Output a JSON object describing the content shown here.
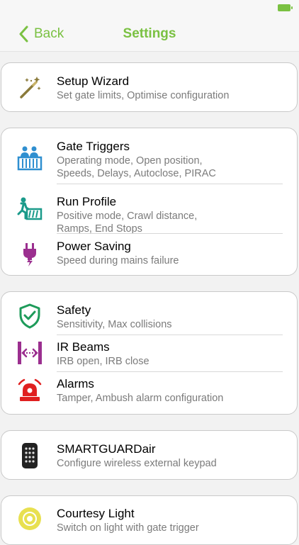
{
  "nav": {
    "back_label": "Back",
    "title": "Settings"
  },
  "colors": {
    "accent": "#7ac142",
    "wizard": "#8a7a3a",
    "blue": "#2f8fd0",
    "teal": "#1a9a8a",
    "purple": "#9b2f8f",
    "green": "#1e9b5a",
    "red": "#e02020",
    "yellow": "#e8e050"
  },
  "groups": [
    {
      "items": [
        {
          "title": "Setup Wizard",
          "subtitle": [
            "Set gate limits, Optimise configuration"
          ],
          "icon": "magic-wand-icon"
        }
      ]
    },
    {
      "items": [
        {
          "title": "Gate Triggers",
          "subtitle": [
            "Operating mode, Open position,",
            "Speeds, Delays, Autoclose, PIRAC"
          ],
          "icon": "gate-people-icon"
        },
        {
          "title": "Run Profile",
          "subtitle": [
            "Positive mode, Crawl distance,",
            "Ramps, End Stops"
          ],
          "icon": "running-gate-icon"
        },
        {
          "title": "Power Saving",
          "subtitle": [
            "Speed during mains failure"
          ],
          "icon": "power-plug-icon"
        }
      ]
    },
    {
      "items": [
        {
          "title": "Safety",
          "subtitle": [
            "Sensitivity, Max collisions"
          ],
          "icon": "shield-check-icon"
        },
        {
          "title": "IR Beams",
          "subtitle": [
            "IRB open, IRB close"
          ],
          "icon": "ir-beam-icon"
        },
        {
          "title": "Alarms",
          "subtitle": [
            "Tamper, Ambush alarm configuration"
          ],
          "icon": "alarm-siren-icon"
        }
      ]
    },
    {
      "items": [
        {
          "title": "SMARTGUARDair",
          "subtitle": [
            "Configure wireless external keypad"
          ],
          "icon": "keypad-icon"
        }
      ]
    },
    {
      "items": [
        {
          "title": "Courtesy Light",
          "subtitle": [
            "Switch on light with gate trigger"
          ],
          "icon": "light-bulb-icon"
        }
      ]
    }
  ]
}
